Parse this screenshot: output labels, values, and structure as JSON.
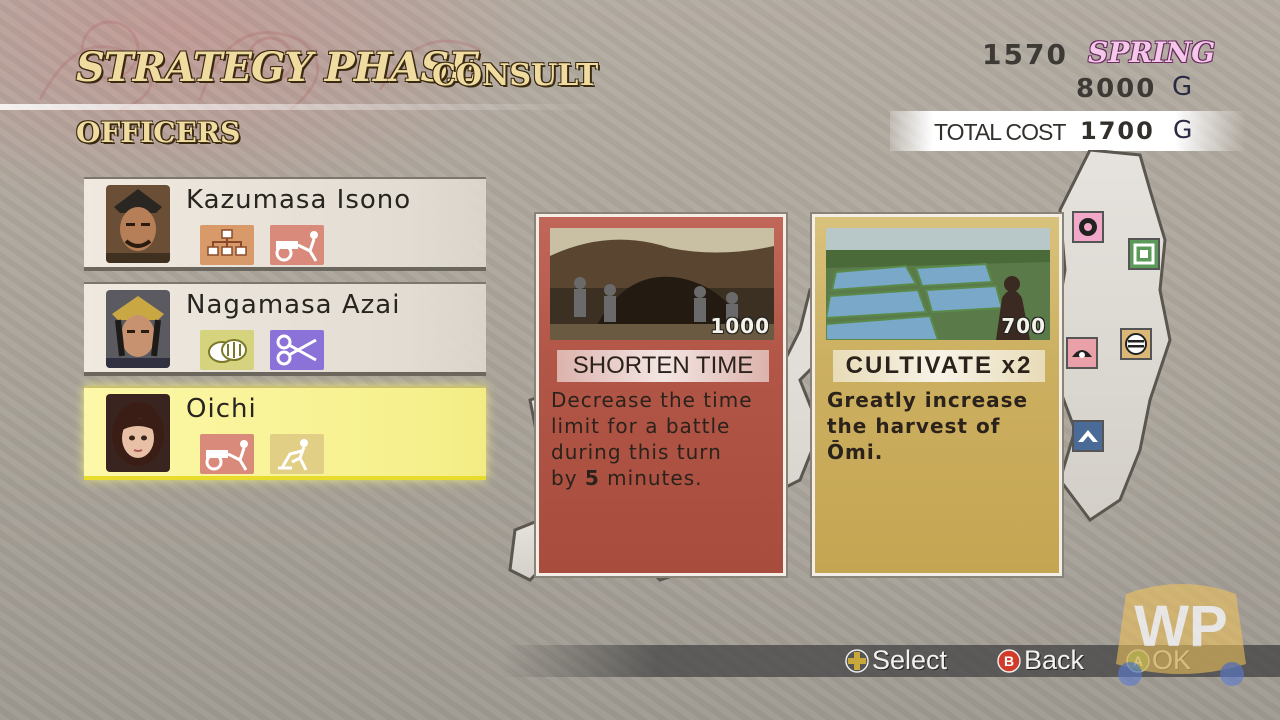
{
  "header": {
    "title": "STRATEGY PHASE",
    "subtitle": "CONSULT",
    "section": "OFFICERS"
  },
  "status": {
    "year": "1570",
    "season": "SPRING",
    "gold": "8000",
    "gold_unit": "G",
    "total_cost_label": "TOTAL COST",
    "total_cost": "1700",
    "total_cost_unit": "G"
  },
  "officers": [
    {
      "name": "Kazumasa Isono",
      "skills": [
        "formation-icon",
        "cart-icon"
      ],
      "selected": false
    },
    {
      "name": "Nagamasa Azai",
      "skills": [
        "coins-icon",
        "scissors-icon"
      ],
      "selected": false
    },
    {
      "name": "Oichi",
      "skills": [
        "cart-icon",
        "farming-icon"
      ],
      "selected": true
    }
  ],
  "cards": [
    {
      "name": "SHORTEN TIME",
      "cost": "1000",
      "color": "#b25647",
      "desc_pre": "Decrease the time\nlimit for a battle\nduring this turn\nby ",
      "desc_bold": "5",
      "desc_post": " minutes."
    },
    {
      "name": "CULTIVATE x2",
      "cost": "700",
      "color": "#ccb061",
      "desc_pre": "Greatly increase\nthe harvest of\nŌmi.",
      "desc_bold": "",
      "desc_post": ""
    }
  ],
  "footer": {
    "select": "Select",
    "back": "Back",
    "ok": "OK"
  },
  "watermark": "WP",
  "colors": {
    "selected_row": "#f6f08c",
    "title_text": "#f0dba0",
    "season_text": "#f4c8e8"
  }
}
